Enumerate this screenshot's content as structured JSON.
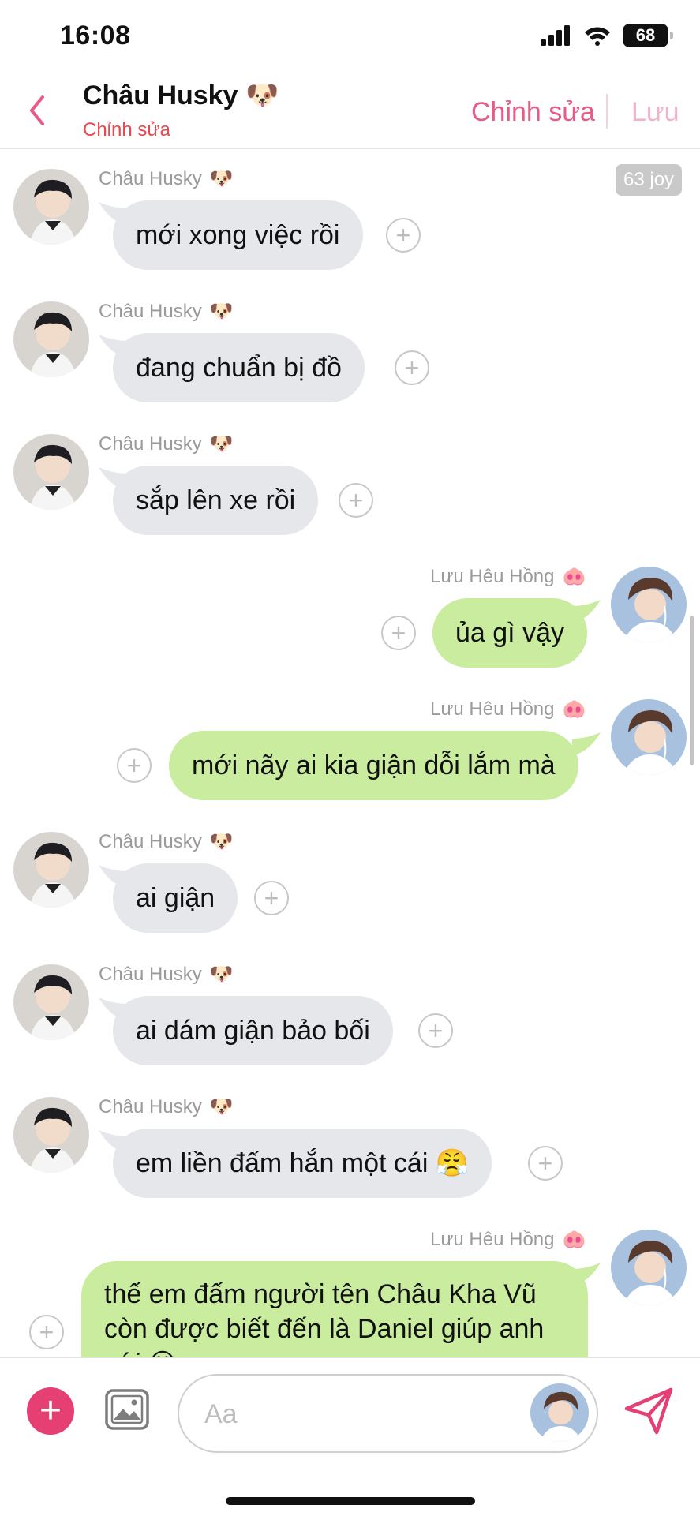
{
  "status_bar": {
    "time": "16:08",
    "battery": "68"
  },
  "header": {
    "title": "Châu Husky",
    "title_emoji": "🐶",
    "subtitle": "Chỉnh sửa",
    "edit_label": "Chỉnh sửa",
    "save_label": "Lưu"
  },
  "chat": {
    "joy_badge": "63 joy",
    "messages": [
      {
        "side": "in",
        "sender": "Châu Husky",
        "emoji": "🐶",
        "text": "mới xong việc rồi"
      },
      {
        "side": "in",
        "sender": "Châu Husky",
        "emoji": "🐶",
        "text": "đang chuẩn bị đồ"
      },
      {
        "side": "in",
        "sender": "Châu Husky",
        "emoji": "🐶",
        "text": "sắp lên xe rồi"
      },
      {
        "side": "out",
        "sender": "Lưu Hêu Hồng",
        "emoji": "🐽",
        "text": "ủa gì vậy"
      },
      {
        "side": "out",
        "sender": "Lưu Hêu Hồng",
        "emoji": "🐽",
        "text": "mới nãy ai kia giận dỗi lắm mà"
      },
      {
        "side": "in",
        "sender": "Châu Husky",
        "emoji": "🐶",
        "text": "ai giận"
      },
      {
        "side": "in",
        "sender": "Châu Husky",
        "emoji": "🐶",
        "text": "ai dám giận bảo bối"
      },
      {
        "side": "in",
        "sender": "Châu Husky",
        "emoji": "🐶",
        "text": "em liền đấm hắn một cái 😤"
      },
      {
        "side": "out",
        "sender": "Lưu Hêu Hồng",
        "emoji": "🐽",
        "text": "thế em đấm người tên Châu Kha Vũ còn được biết đến là Daniel giúp anh với 😊"
      }
    ]
  },
  "composer": {
    "placeholder": "Aa"
  },
  "colors": {
    "accent": "#e85b86",
    "incoming_bubble": "#e6e7eb",
    "outgoing_bubble": "#c9ec9e",
    "add_button": "#e63f74"
  }
}
